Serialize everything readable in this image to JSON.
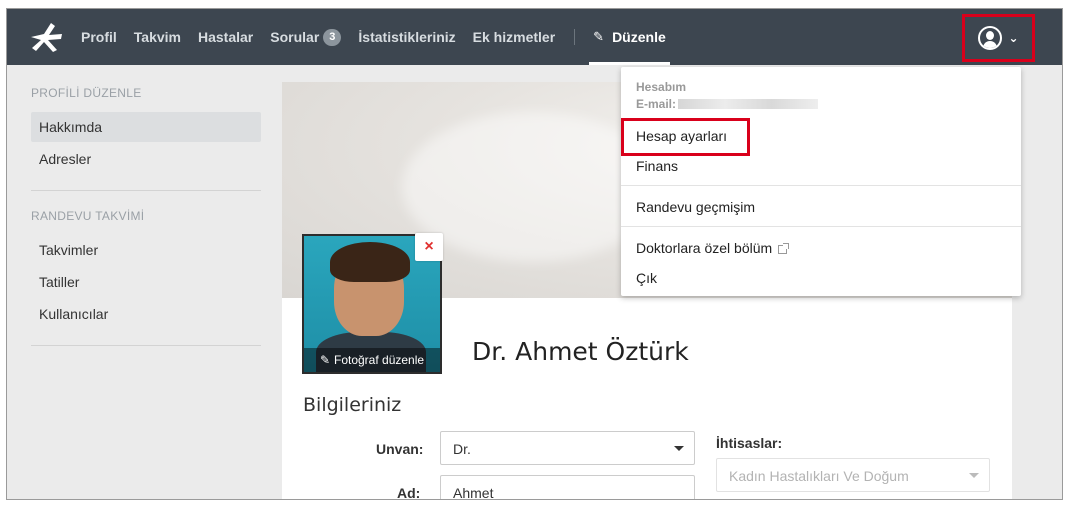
{
  "nav": {
    "items": [
      {
        "label": "Profil"
      },
      {
        "label": "Takvim"
      },
      {
        "label": "Hastalar"
      },
      {
        "label": "Sorular",
        "badge": "3"
      },
      {
        "label": "İstatistikleriniz"
      },
      {
        "label": "Ek hizmetler"
      }
    ],
    "edit_label": "Düzenle"
  },
  "sidebar": {
    "profile_heading": "PROFİLİ DÜZENLE",
    "profile_items": [
      "Hakkımda",
      "Adresler"
    ],
    "calendar_heading": "RANDEVU TAKVİMİ",
    "calendar_items": [
      "Takvimler",
      "Tatiller",
      "Kullanıcılar"
    ]
  },
  "profile": {
    "photo_edit_label": "Fotoğraf düzenle",
    "remove_icon": "×",
    "name": "Dr. Ahmet Öztürk",
    "section_title": "Bilgileriniz"
  },
  "form": {
    "title_label": "Unvan:",
    "title_value": "Dr.",
    "first_name_label": "Ad:",
    "first_name_value": "Ahmet",
    "specialty_label": "İhtisaslar:",
    "specialty_placeholder": "Kadın Hastalıkları Ve Doğum"
  },
  "account_menu": {
    "heading": "Hesabım",
    "email_label": "E-mail:",
    "items": [
      "Hesap ayarları",
      "Finans",
      "Randevu geçmişim",
      "Doktorlara özel bölüm",
      "Çık"
    ]
  },
  "colors": {
    "topbar": "#3d4650",
    "highlight": "#d9001b",
    "remove": "#e0302f"
  }
}
